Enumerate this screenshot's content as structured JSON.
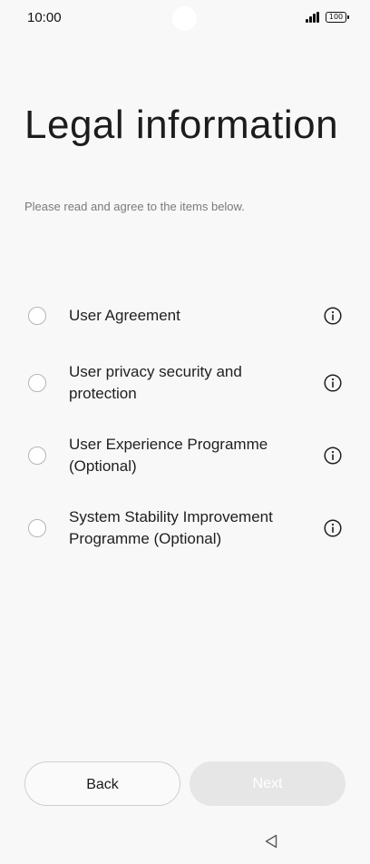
{
  "status_bar": {
    "time": "10:00",
    "battery_level": "100",
    "icons": [
      "camera-hole",
      "signal-icon",
      "battery-icon"
    ]
  },
  "page": {
    "title": "Legal information",
    "subtitle": "Please read and agree to the items below."
  },
  "items": [
    {
      "label": "User Agreement",
      "checked": false,
      "info_icon": "info-icon"
    },
    {
      "label": "User privacy security and protection",
      "checked": false,
      "info_icon": "info-icon"
    },
    {
      "label": "User Experience Programme (Optional)",
      "checked": false,
      "info_icon": "info-icon"
    },
    {
      "label": "System Stability Improvement Programme (Optional)",
      "checked": false,
      "info_icon": "info-icon"
    }
  ],
  "buttons": {
    "back": "Back",
    "next": "Next",
    "next_enabled": false
  },
  "nav_bar": {
    "back_icon": "nav-back-triangle-icon"
  },
  "colors": {
    "background": "#f8f8f8",
    "text_primary": "#1f1f1f",
    "text_secondary": "#7a7a7a",
    "button_disabled_bg": "#e6e6e6",
    "radio_border": "#b5b5b5"
  }
}
